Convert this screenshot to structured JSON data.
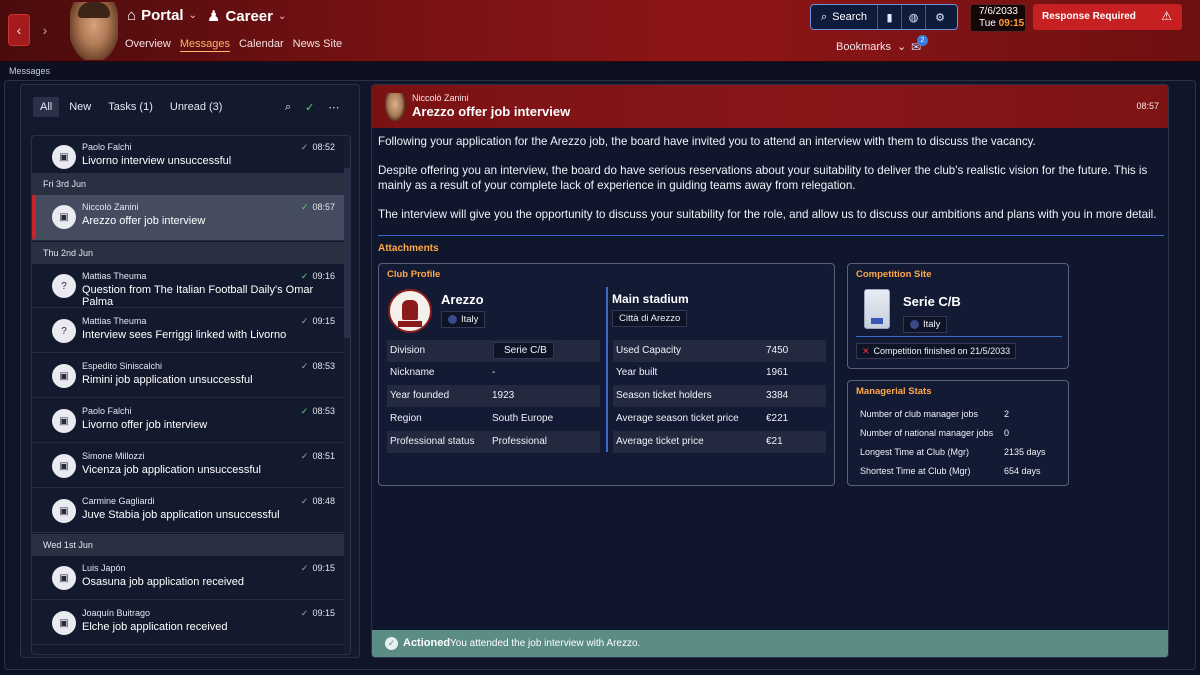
{
  "topbar": {
    "back_icon": "chevron-left-icon",
    "forward_icon": "chevron-right-icon",
    "portal_label": "Portal",
    "career_label": "Career",
    "tabs": [
      {
        "label": "Overview"
      },
      {
        "label": "Messages",
        "active": true
      },
      {
        "label": "Calendar"
      },
      {
        "label": "News Site"
      }
    ],
    "search_label": "Search",
    "bookmarks_label": "Bookmarks",
    "inbox_count": "2",
    "date": "7/6/2033",
    "day": "Tue",
    "time": "09:15",
    "response_label": "Response Required",
    "accent_color": "#8e1517"
  },
  "page": {
    "section_title": "Messages"
  },
  "list": {
    "filters": [
      {
        "label": "All",
        "active": true
      },
      {
        "label": "New"
      },
      {
        "label": "Tasks (1)"
      },
      {
        "label": "Unread (3)"
      }
    ],
    "items": [
      {
        "sender": "Paolo Falchi",
        "subject": "Livorno interview unsuccessful",
        "time": "08:52",
        "read_green": false,
        "icon": "briefcase-icon"
      },
      {
        "separator": "Fri 3rd Jun"
      },
      {
        "sender": "Niccolò Zanini",
        "subject": "Arezzo offer job interview",
        "time": "08:57",
        "read_green": true,
        "selected": true,
        "icon": "briefcase-icon"
      },
      {
        "separator": "Thu 2nd Jun"
      },
      {
        "sender": "Mattias Theuma",
        "subject": "Question from The Italian Football Daily's Omar Palma",
        "time": "09:16",
        "read_green": true,
        "icon": "question-icon"
      },
      {
        "sender": "Mattias Theuma",
        "subject": "Interview sees Ferriggi linked with Livorno",
        "time": "09:15",
        "read_green": false,
        "icon": "question-icon"
      },
      {
        "sender": "Espedito Siniscalchi",
        "subject": "Rimini job application unsuccessful",
        "time": "08:53",
        "read_green": false,
        "icon": "briefcase-icon"
      },
      {
        "sender": "Paolo Falchi",
        "subject": "Livorno offer job interview",
        "time": "08:53",
        "read_green": true,
        "icon": "briefcase-icon"
      },
      {
        "sender": "Simone Millozzi",
        "subject": "Vicenza job application unsuccessful",
        "time": "08:51",
        "read_green": false,
        "icon": "briefcase-icon"
      },
      {
        "sender": "Carmine Gagliardi",
        "subject": "Juve Stabia job application unsuccessful",
        "time": "08:48",
        "read_green": false,
        "icon": "briefcase-icon"
      },
      {
        "separator": "Wed 1st Jun"
      },
      {
        "sender": "Luis Japón",
        "subject": "Osasuna job application received",
        "time": "09:15",
        "read_green": false,
        "icon": "briefcase-icon"
      },
      {
        "sender": "Joaquín Buitrago",
        "subject": "Elche job application received",
        "time": "09:15",
        "read_green": false,
        "icon": "briefcase-icon"
      }
    ]
  },
  "message": {
    "from": "Niccolò Zanini",
    "title": "Arezzo offer job interview",
    "time": "08:57",
    "paragraphs": [
      "Following your application for the Arezzo job, the board have invited you to attend an interview with them to discuss the vacancy.",
      "Despite offering you an interview, the board do have serious reservations about your suitability to deliver the club's realistic vision for the future. This is mainly as a result of your complete lack of experience in guiding teams away from relegation.",
      "The interview will give you the opportunity to discuss your suitability for the role, and allow us to discuss our ambitions and plans with you in more detail."
    ],
    "attachments_label": "Attachments",
    "club_profile": {
      "label": "Club Profile",
      "name": "Arezzo",
      "nation": "Italy",
      "rows": [
        {
          "k": "Division",
          "v": "Serie C/B",
          "chip": true
        },
        {
          "k": "Nickname",
          "v": "-"
        },
        {
          "k": "Year founded",
          "v": "1923"
        },
        {
          "k": "Region",
          "v": "South Europe"
        },
        {
          "k": "Professional status",
          "v": "Professional"
        }
      ],
      "stadium_title": "Main stadium",
      "stadium_name": "Città di Arezzo",
      "stadium_rows": [
        {
          "k": "Used Capacity",
          "v": "7450"
        },
        {
          "k": "Year built",
          "v": "1961"
        },
        {
          "k": "Season ticket holders",
          "v": "3384"
        },
        {
          "k": "Average season ticket price",
          "v": "€221"
        },
        {
          "k": "Average ticket price",
          "v": "€21"
        }
      ]
    },
    "competition": {
      "label": "Competition Site",
      "name": "Serie C/B",
      "nation": "Italy",
      "status": "Competition finished on 21/5/2033"
    },
    "managerial_stats": {
      "label": "Managerial Stats",
      "rows": [
        {
          "k": "Number of club manager jobs",
          "v": "2"
        },
        {
          "k": "Number of national manager jobs",
          "v": "0"
        },
        {
          "k": "Longest Time at Club (Mgr)",
          "v": "2135 days"
        },
        {
          "k": "Shortest Time at Club (Mgr)",
          "v": "654 days"
        }
      ]
    },
    "actioned_label": "Actioned",
    "actioned_text": "You attended the job interview with Arezzo."
  }
}
